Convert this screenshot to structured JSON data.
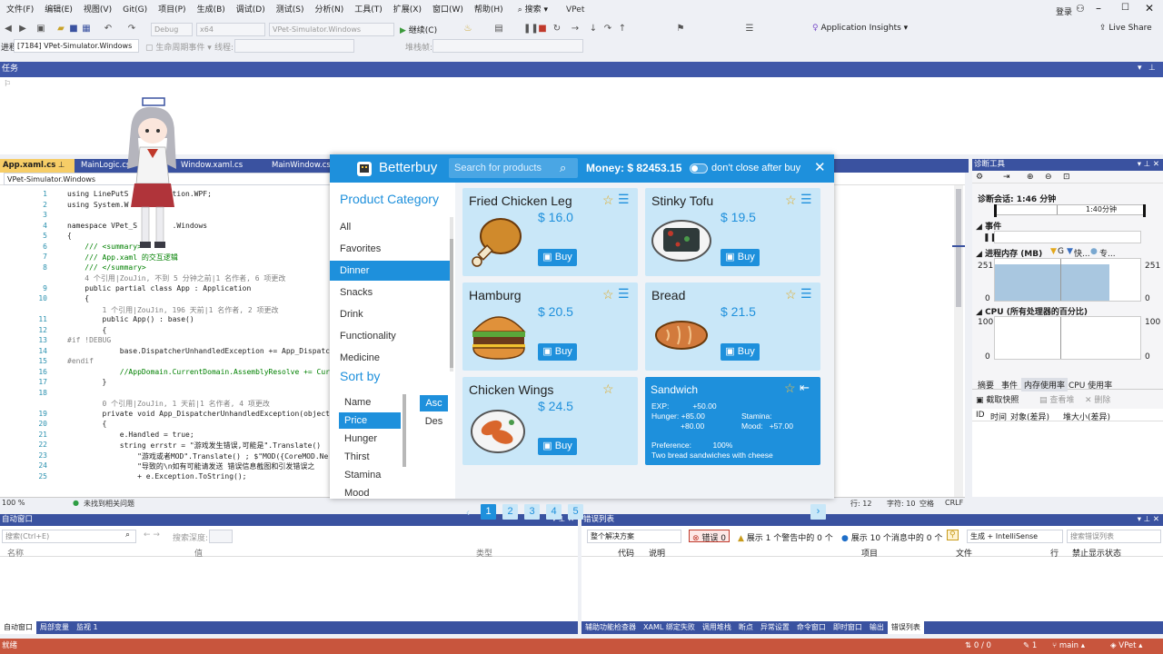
{
  "menu": [
    "文件(F)",
    "编辑(E)",
    "视图(V)",
    "Git(G)",
    "项目(P)",
    "生成(B)",
    "调试(D)",
    "测试(S)",
    "分析(N)",
    "工具(T)",
    "扩展(X)",
    "窗口(W)",
    "帮助(H)"
  ],
  "search_label": "搜索",
  "solution_name": "VPet",
  "login": "登录",
  "toolbar": {
    "config": "Debug",
    "platform": "x64",
    "startup": "VPet-Simulator.Windows",
    "continue": "继续(C)",
    "insights": "Application Insights",
    "live_share": "Live Share",
    "process_label": "进程:",
    "process": "[7184] VPet-Simulator.Windows",
    "lifecycle": "生命周期事件",
    "thread": "线程:",
    "stackframe": "堆栈帧:"
  },
  "tasks_title": "任务",
  "doc_tabs": [
    "App.xaml.cs",
    "MainLogic.cs",
    "Window.xaml.cs",
    "MainWindow.cs"
  ],
  "nav_project": "VPet-Simulator.Windows",
  "code_lines": [
    {
      "n": "1",
      "t": "using LinePutS      lization.WPF;"
    },
    {
      "n": "2",
      "t": "using System.W"
    },
    {
      "n": "3",
      "t": ""
    },
    {
      "n": "4",
      "t": "namespace VPet_S        .Windows"
    },
    {
      "n": "5",
      "t": "{"
    },
    {
      "n": "6",
      "t": "    /// <summary>"
    },
    {
      "n": "7",
      "t": "    /// App.xaml 的交互逻辑"
    },
    {
      "n": "8",
      "t": "    /// </summary>"
    },
    {
      "n": "",
      "t": "    4 个引用|ZouJin, 不到 5 分钟之前|1 名作者, 6 项更改"
    },
    {
      "n": "9",
      "t": "    public partial class App : Application"
    },
    {
      "n": "10",
      "t": "    {"
    },
    {
      "n": "",
      "t": "        1 个引用|ZouJin, 196 天前|1 名作者, 2 项更改"
    },
    {
      "n": "11",
      "t": "        public App() : base()"
    },
    {
      "n": "12",
      "t": "        {"
    },
    {
      "n": "13",
      "t": "#if !DEBUG"
    },
    {
      "n": "14",
      "t": "            base.DispatcherUnhandledException += App_Dispatc"
    },
    {
      "n": "15",
      "t": "#endif"
    },
    {
      "n": "16",
      "t": "            //AppDomain.CurrentDomain.AssemblyResolve += Cur"
    },
    {
      "n": "17",
      "t": "        }"
    },
    {
      "n": "18",
      "t": ""
    },
    {
      "n": "",
      "t": "        0 个引用|ZouJin, 1 天前|1 名作者, 4 项更改"
    },
    {
      "n": "19",
      "t": "        private void App_DispatcherUnhandledException(object"
    },
    {
      "n": "20",
      "t": "        {"
    },
    {
      "n": "21",
      "t": "            e.Handled = true;"
    },
    {
      "n": "22",
      "t": "            string errstr = \"游戏发生错误,可能是\".Translate()"
    },
    {
      "n": "23",
      "t": "                \"游戏或者MOD\".Translate() ; $\"MOD({CoreMOD.Ne"
    },
    {
      "n": "24",
      "t": "                \"导致的\\n如有可能请发送 错误信息截图和引发错误之"
    },
    {
      "n": "25",
      "t": "                + e.Exception.ToString();"
    }
  ],
  "editor_status": {
    "zoom": "100 %",
    "issues": "未找到相关问题",
    "line": "行: 12",
    "col": "字符: 10",
    "ws": "空格",
    "eol": "CRLF"
  },
  "diag": {
    "title": "诊断工具",
    "session": "诊断会话: 1:46 分钟",
    "time_mark": "1:40分钟",
    "events": "事件",
    "memory": "进程内存 (MB)",
    "mem_legend": [
      "G",
      "快...",
      "专..."
    ],
    "mem_max": "251",
    "mem_min": "0",
    "cpu": "CPU (所有处理器的百分比)",
    "cpu_max": "100",
    "cpu_min": "0",
    "tabs": [
      "摘要",
      "事件",
      "内存使用率",
      "CPU 使用率"
    ],
    "snapshot": "截取快照",
    "view_heap": "查看堆",
    "delete": "删除",
    "cols": [
      "ID",
      "时间",
      "对象(差异)",
      "堆大小(差异)"
    ]
  },
  "auto": {
    "title": "自动窗口",
    "search": "搜索(Ctrl+E)",
    "depth": "搜索深度:",
    "cols": [
      "名称",
      "值",
      "类型"
    ]
  },
  "errors": {
    "title": "错误列表",
    "scope": "整个解决方案",
    "err": "错误 0",
    "warn": "展示 1 个警告中的 0 个",
    "msg": "展示 10 个消息中的 0 个",
    "build": "生成 + IntelliSense",
    "search": "搜索错误列表",
    "cols": [
      "代码",
      "说明",
      "项目",
      "文件",
      "行",
      "禁止显示状态"
    ]
  },
  "left_bottom_tabs": [
    "自动窗口",
    "局部变量",
    "监视 1"
  ],
  "right_bottom_tabs": [
    "辅助功能检查器",
    "XAML 绑定失败",
    "调用堆栈",
    "断点",
    "异常设置",
    "命令窗口",
    "即时窗口",
    "输出",
    "错误列表"
  ],
  "status": {
    "ready": "就绪",
    "changes": "0 / 0",
    "commits": "1",
    "branch": "main",
    "repo": "VPet"
  },
  "shop": {
    "title": "Betterbuy",
    "search_placeholder": "Search for products",
    "money": "Money: $ 82453.15",
    "dont_close": "don't close after buy",
    "category_title": "Product Category",
    "categories": [
      "All",
      "Favorites",
      "Dinner",
      "Snacks",
      "Drink",
      "Functionality",
      "Medicine"
    ],
    "selected_category": "Dinner",
    "sort_title": "Sort by",
    "sort_fields": [
      "Name",
      "Price",
      "Hunger",
      "Thirst",
      "Stamina",
      "Mood"
    ],
    "selected_sort": "Price",
    "asc": "Asc",
    "desc": "Des",
    "buy": "Buy",
    "items": [
      {
        "name": "Fried Chicken Leg",
        "price": "$ 16.0"
      },
      {
        "name": "Stinky Tofu",
        "price": "$ 19.5"
      },
      {
        "name": "Hamburg",
        "price": "$ 20.5"
      },
      {
        "name": "Bread",
        "price": "$ 21.5"
      },
      {
        "name": "Chicken Wings",
        "price": "$ 24.5"
      }
    ],
    "detail": {
      "name": "Sandwich",
      "exp": "EXP:           +50.00",
      "hunger": "Hunger: +85.00",
      "stamina": "Stamina:",
      "extra": "+80.00",
      "mood": "Mood:   +57.00",
      "pref": "Preference:          100%",
      "desc": "Two bread sandwiches with cheese"
    },
    "pages": [
      "1",
      "2",
      "3",
      "4",
      "5"
    ],
    "current_page": "1"
  },
  "colors": {
    "accent": "#1e90dc",
    "card": "#c9e7f8",
    "vs_blue": "#3a52a0",
    "status": "#c8553d"
  }
}
